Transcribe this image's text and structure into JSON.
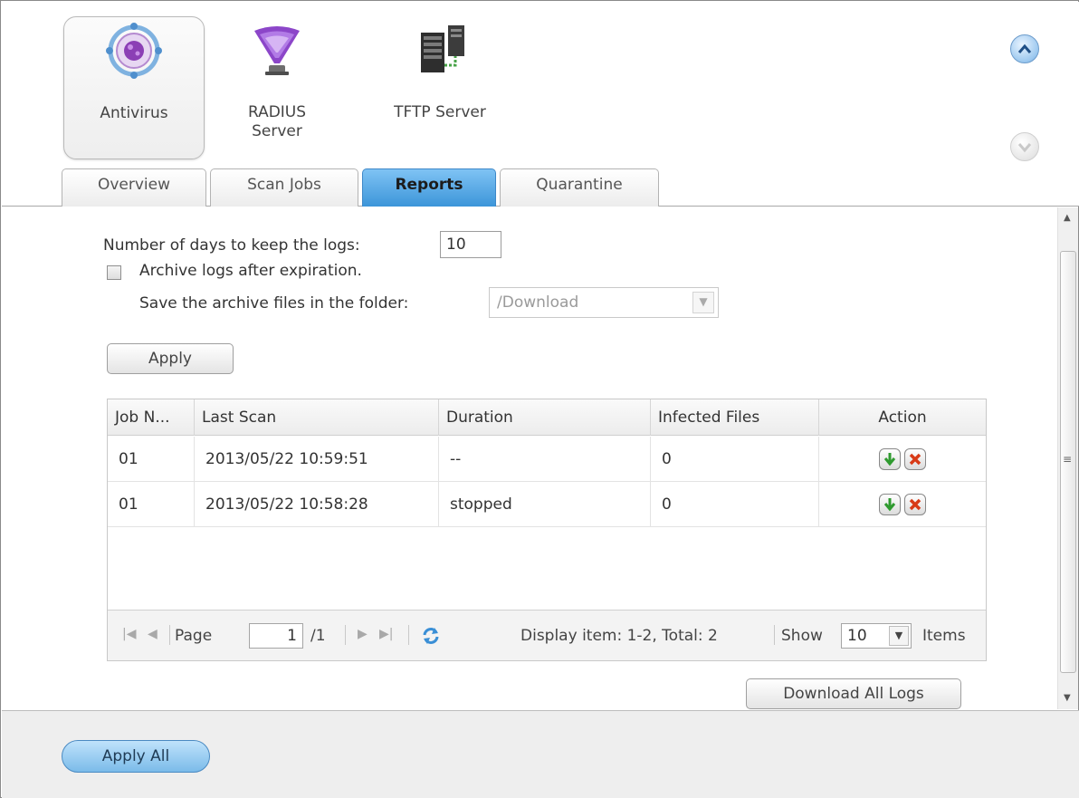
{
  "apps": [
    {
      "label": "Antivirus",
      "icon": "antivirus-icon",
      "selected": true
    },
    {
      "label": "RADIUS\nServer",
      "icon": "radius-server-icon",
      "selected": false
    },
    {
      "label": "TFTP Server",
      "icon": "tftp-server-icon",
      "selected": false
    }
  ],
  "tabs": [
    {
      "label": "Overview",
      "active": false
    },
    {
      "label": "Scan Jobs",
      "active": false
    },
    {
      "label": "Reports",
      "active": true
    },
    {
      "label": "Quarantine",
      "active": false
    }
  ],
  "settings": {
    "days_label": "Number of days to keep the logs:",
    "days_value": "10",
    "archive_label": "Archive logs after expiration.",
    "archive_checked": false,
    "folder_label": "Save the archive files in the folder:",
    "folder_value": "/Download",
    "apply_label": "Apply"
  },
  "grid": {
    "columns": [
      "Job N...",
      "Last Scan",
      "Duration",
      "Infected Files",
      "Action"
    ],
    "rows": [
      {
        "job": "01",
        "last_scan": "2013/05/22 10:59:51",
        "duration": "--",
        "infected": "0"
      },
      {
        "job": "01",
        "last_scan": "2013/05/22 10:58:28",
        "duration": "stopped",
        "infected": "0"
      }
    ]
  },
  "pager": {
    "page_label": "Page",
    "page_value": "1",
    "page_total": "/1",
    "display_text": "Display item: 1-2, Total: 2",
    "show_label": "Show",
    "show_value": "10",
    "items_label": "Items"
  },
  "download_all_label": "Download All Logs",
  "apply_all_label": "Apply All"
}
